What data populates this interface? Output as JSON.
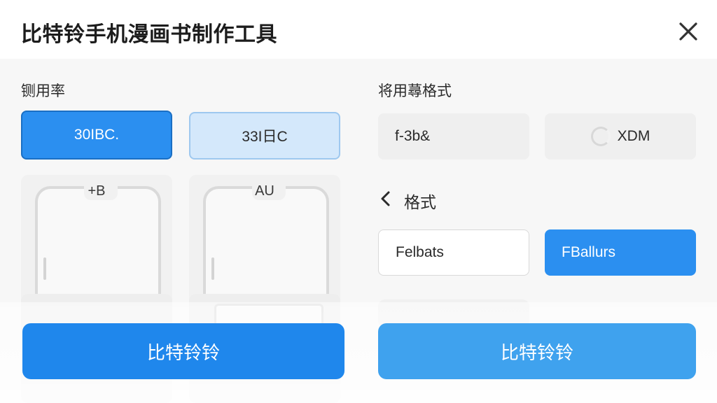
{
  "header": {
    "title": "比特铃手机漫画书制作工具",
    "close_icon": "close-icon"
  },
  "left": {
    "section_label": "铡用率",
    "options": [
      {
        "label": "30IBC.",
        "state": "selected"
      },
      {
        "label": "33I日C",
        "state": "hover"
      }
    ],
    "phone_cards": [
      {
        "label": "+B"
      },
      {
        "label": "AU"
      }
    ]
  },
  "right": {
    "section_label": "将用蕁格式",
    "options": [
      {
        "label": "f-3b&"
      },
      {
        "label": "XDM"
      }
    ],
    "back_icon": "chevron-left-icon",
    "sub_label": "格式",
    "format_options": [
      {
        "label": "Felbats",
        "state": "unselected"
      },
      {
        "label": "FBallurs",
        "state": "selected"
      }
    ]
  },
  "actions": {
    "primary_label": "比特铃铃",
    "secondary_label": "比特铃铃"
  },
  "colors": {
    "accent": "#2b8ff0",
    "accent_dark": "#1a6fc4",
    "accent_light": "#d4e8fb",
    "background": "#f7f7f7"
  }
}
